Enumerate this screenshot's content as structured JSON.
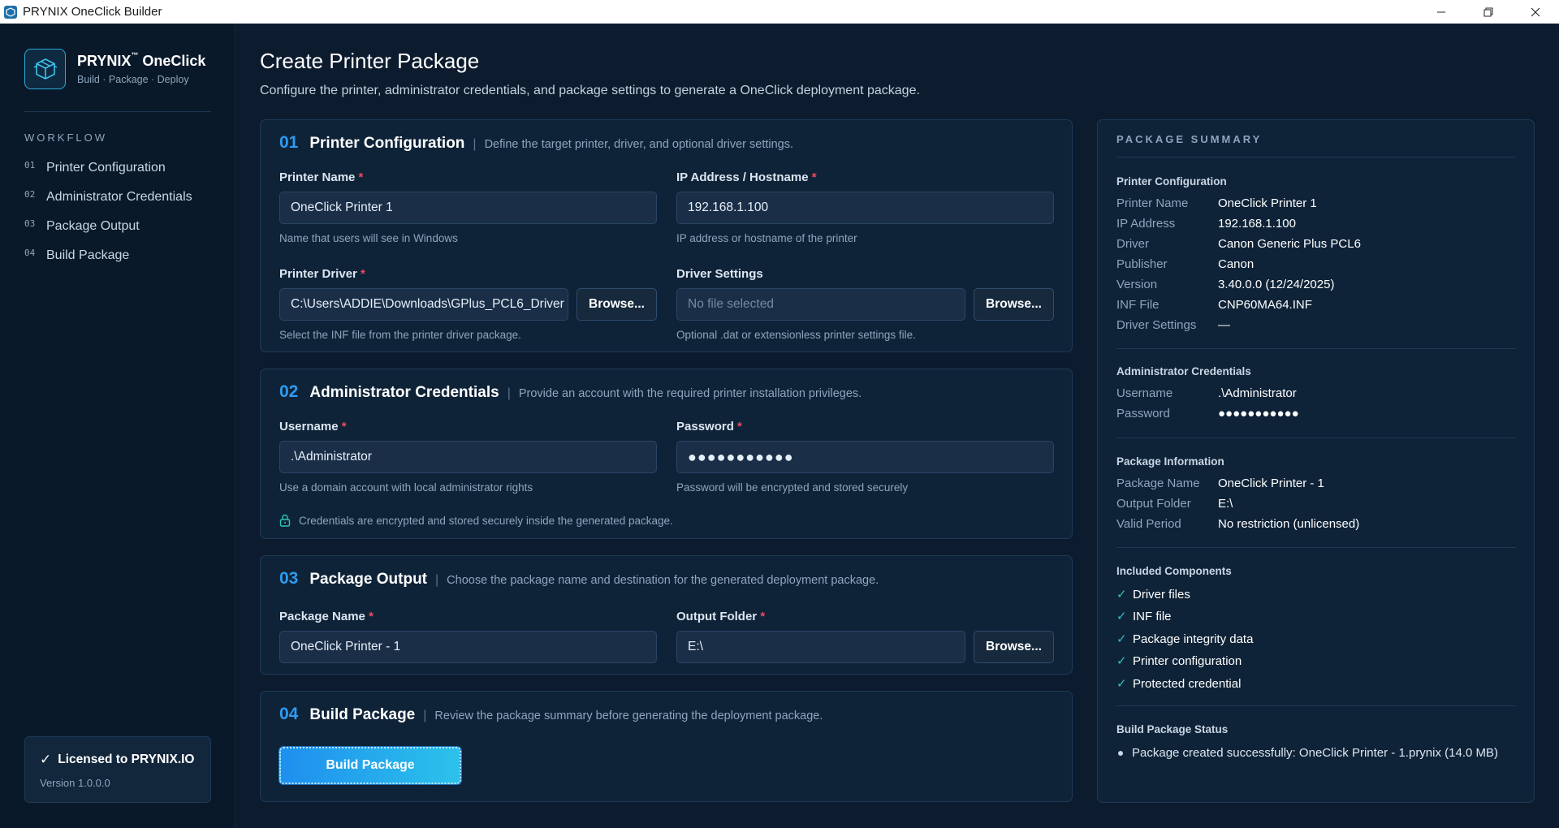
{
  "window": {
    "title": "PRYNIX OneClick Builder"
  },
  "brand": {
    "name": "PRYNIX",
    "trademark": "™",
    "product": "OneClick",
    "tagline": "Build · Package · Deploy",
    "accent_color": "#2aa9d8"
  },
  "sidebar": {
    "section_title": "WORKFLOW",
    "items": [
      {
        "num": "01",
        "label": "Printer Configuration"
      },
      {
        "num": "02",
        "label": "Administrator Credentials"
      },
      {
        "num": "03",
        "label": "Package Output"
      },
      {
        "num": "04",
        "label": "Build Package"
      }
    ],
    "license": {
      "check": "✓",
      "text": "Licensed to PRYNIX.IO",
      "version": "Version 1.0.0.0"
    }
  },
  "page": {
    "title": "Create Printer Package",
    "subtitle": "Configure the printer, administrator credentials, and package settings to generate a OneClick deployment package."
  },
  "sections": {
    "printer": {
      "num": "01",
      "title": "Printer Configuration",
      "desc": "Define the target printer, driver, and optional driver settings.",
      "printer_name_label": "Printer Name",
      "printer_name_value": "OneClick Printer 1",
      "printer_name_hint": "Name that users will see in Windows",
      "ip_label": "IP Address / Hostname",
      "ip_value": "192.168.1.100",
      "ip_hint": "IP address or hostname of the printer",
      "driver_label": "Printer Driver",
      "driver_value": "C:\\Users\\ADDIE\\Downloads\\GPlus_PCL6_Driver",
      "driver_hint": "Select the INF file from the printer driver package.",
      "settings_label": "Driver Settings",
      "settings_placeholder": "No file selected",
      "settings_hint": "Optional .dat or extensionless printer settings file.",
      "browse_label": "Browse..."
    },
    "credentials": {
      "num": "02",
      "title": "Administrator Credentials",
      "desc": "Provide an account with the required printer installation privileges.",
      "username_label": "Username",
      "username_value": ".\\Administrator",
      "username_hint": "Use a domain account with local administrator rights",
      "password_label": "Password",
      "password_value": "●●●●●●●●●●●",
      "password_hint": "Password will be encrypted and stored securely",
      "note": "Credentials are encrypted and stored securely inside the generated package."
    },
    "output": {
      "num": "03",
      "title": "Package Output",
      "desc": "Choose the package name and destination for the generated deployment package.",
      "package_name_label": "Package Name",
      "package_name_value": "OneClick Printer - 1",
      "folder_label": "Output Folder",
      "folder_value": "E:\\",
      "browse_label": "Browse..."
    },
    "build": {
      "num": "04",
      "title": "Build Package",
      "desc": "Review the package summary before generating the deployment package.",
      "button_label": "Build Package"
    },
    "required_mark": "*",
    "separator": "|"
  },
  "summary": {
    "title": "PACKAGE SUMMARY",
    "printer_section": "Printer Configuration",
    "printer_rows": [
      {
        "key": "Printer Name",
        "value": "OneClick Printer 1"
      },
      {
        "key": "IP Address",
        "value": "192.168.1.100"
      },
      {
        "key": "Driver",
        "value": "Canon Generic Plus PCL6"
      },
      {
        "key": "Publisher",
        "value": "Canon"
      },
      {
        "key": "Version",
        "value": "3.40.0.0 (12/24/2025)"
      },
      {
        "key": "INF File",
        "value": "CNP60MA64.INF"
      },
      {
        "key": "Driver Settings",
        "value": "—"
      }
    ],
    "cred_section": "Administrator Credentials",
    "cred_rows": [
      {
        "key": "Username",
        "value": ".\\Administrator"
      },
      {
        "key": "Password",
        "value": "●●●●●●●●●●●"
      }
    ],
    "info_section": "Package Information",
    "info_rows": [
      {
        "key": "Package Name",
        "value": "OneClick Printer - 1"
      },
      {
        "key": "Output Folder",
        "value": "E:\\"
      },
      {
        "key": "Valid Period",
        "value": "No restriction (unlicensed)"
      }
    ],
    "components_section": "Included Components",
    "check": "✓",
    "components": [
      "Driver files",
      "INF file",
      "Package integrity data",
      "Printer configuration",
      "Protected credential"
    ],
    "status_section": "Build Package Status",
    "status_text": "Package created successfully: OneClick Printer - 1.prynix (14.0 MB)"
  },
  "colors": {
    "background": "#0c1b2e",
    "card": "#0f2338",
    "accent_blue": "#2e9bf0",
    "required": "#f04a5e",
    "check": "#2ec4b6"
  }
}
